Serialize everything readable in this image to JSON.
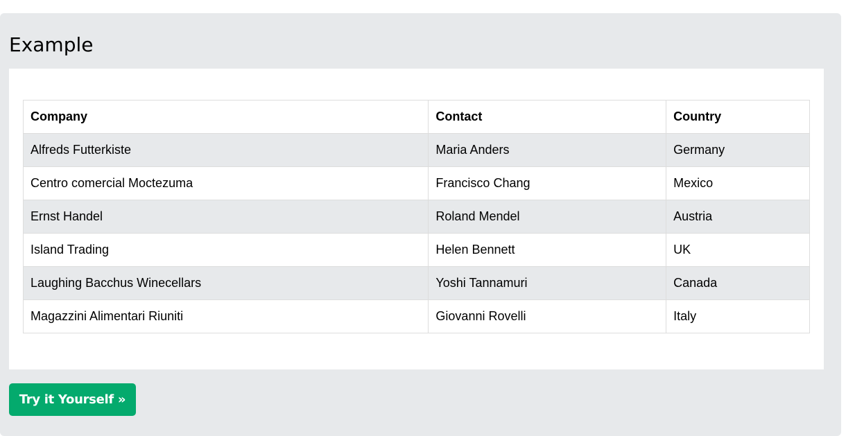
{
  "example": {
    "title": "Example",
    "table": {
      "headers": [
        "Company",
        "Contact",
        "Country"
      ],
      "rows": [
        [
          "Alfreds Futterkiste",
          "Maria Anders",
          "Germany"
        ],
        [
          "Centro comercial Moctezuma",
          "Francisco Chang",
          "Mexico"
        ],
        [
          "Ernst Handel",
          "Roland Mendel",
          "Austria"
        ],
        [
          "Island Trading",
          "Helen Bennett",
          "UK"
        ],
        [
          "Laughing Bacchus Winecellars",
          "Yoshi Tannamuri",
          "Canada"
        ],
        [
          "Magazzini Alimentari Riuniti",
          "Giovanni Rovelli",
          "Italy"
        ]
      ]
    },
    "button_label": "Try it Yourself »"
  },
  "colors": {
    "panel_background": "#e7e9eb",
    "button_green": "#04aa6d",
    "stripe": "#e7e9eb",
    "border": "#dddddd"
  }
}
